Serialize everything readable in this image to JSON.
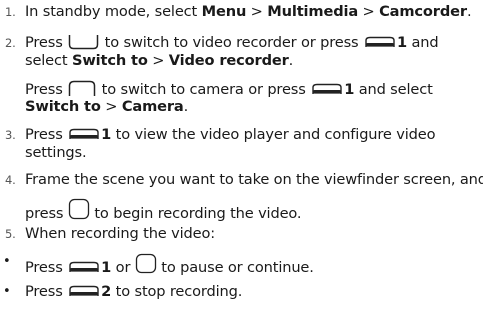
{
  "steps": {
    "s1": {
      "num": "1.",
      "t1": "In standby mode, select ",
      "b1": "Menu",
      "t2": " > ",
      "b2": "Multimedia",
      "t3": " > ",
      "b3": "Camcorder",
      "t4": "."
    },
    "s2": {
      "num": "2.",
      "t1": "Press ",
      "t2": " to switch to video recorder or press ",
      "key_digit": "1",
      "t3": " and",
      "t4": "select ",
      "b1": "Switch to",
      "t5": " > ",
      "b2": "Video recorder",
      "t6": ".",
      "t7": "Press ",
      "t8": " to switch to camera or press ",
      "key_digit2": "1",
      "t9": " and select",
      "b3": "Switch to",
      "t10": " > ",
      "b4": "Camera",
      "t11": "."
    },
    "s3": {
      "num": "3.",
      "t1": "Press ",
      "key_digit": "1",
      "t2": " to view the video player and configure video",
      "t3": "settings."
    },
    "s4": {
      "num": "4.",
      "t1": "Frame the scene you want to take on the viewfinder screen, and",
      "t2": "press ",
      "t3": " to begin recording the video."
    },
    "s5": {
      "num": "5.",
      "t1": "When recording the video:"
    }
  },
  "bullets": {
    "b1": {
      "mark": "•",
      "t1": "Press ",
      "key_digit": "1",
      "t2": " or ",
      "t3": " to pause or continue."
    },
    "b2": {
      "mark": "•",
      "t1": "Press ",
      "key_digit": "2",
      "t2": " to stop recording."
    }
  },
  "icons": {
    "softkey": "left-softkey-icon",
    "rightkey": "right-softkey-icon",
    "okkey": "confirm-key-icon",
    "sidekey": "side-key-icon"
  }
}
